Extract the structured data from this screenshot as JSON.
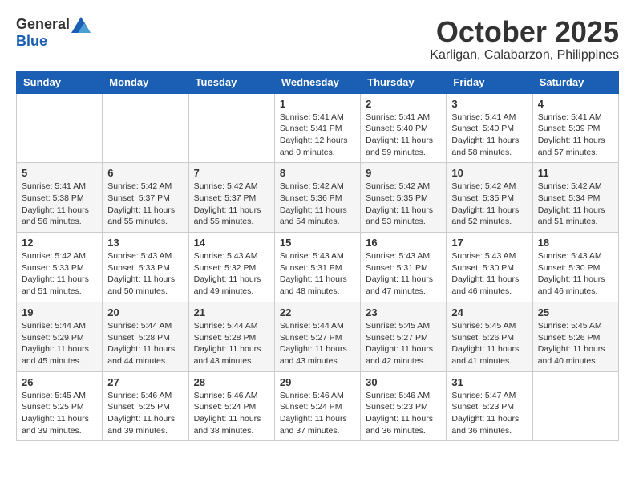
{
  "header": {
    "logo_general": "General",
    "logo_blue": "Blue",
    "month": "October 2025",
    "location": "Karligan, Calabarzon, Philippines"
  },
  "weekdays": [
    "Sunday",
    "Monday",
    "Tuesday",
    "Wednesday",
    "Thursday",
    "Friday",
    "Saturday"
  ],
  "weeks": [
    [
      {
        "day": "",
        "info": ""
      },
      {
        "day": "",
        "info": ""
      },
      {
        "day": "",
        "info": ""
      },
      {
        "day": "1",
        "info": "Sunrise: 5:41 AM\nSunset: 5:41 PM\nDaylight: 12 hours\nand 0 minutes."
      },
      {
        "day": "2",
        "info": "Sunrise: 5:41 AM\nSunset: 5:40 PM\nDaylight: 11 hours\nand 59 minutes."
      },
      {
        "day": "3",
        "info": "Sunrise: 5:41 AM\nSunset: 5:40 PM\nDaylight: 11 hours\nand 58 minutes."
      },
      {
        "day": "4",
        "info": "Sunrise: 5:41 AM\nSunset: 5:39 PM\nDaylight: 11 hours\nand 57 minutes."
      }
    ],
    [
      {
        "day": "5",
        "info": "Sunrise: 5:41 AM\nSunset: 5:38 PM\nDaylight: 11 hours\nand 56 minutes."
      },
      {
        "day": "6",
        "info": "Sunrise: 5:42 AM\nSunset: 5:37 PM\nDaylight: 11 hours\nand 55 minutes."
      },
      {
        "day": "7",
        "info": "Sunrise: 5:42 AM\nSunset: 5:37 PM\nDaylight: 11 hours\nand 55 minutes."
      },
      {
        "day": "8",
        "info": "Sunrise: 5:42 AM\nSunset: 5:36 PM\nDaylight: 11 hours\nand 54 minutes."
      },
      {
        "day": "9",
        "info": "Sunrise: 5:42 AM\nSunset: 5:35 PM\nDaylight: 11 hours\nand 53 minutes."
      },
      {
        "day": "10",
        "info": "Sunrise: 5:42 AM\nSunset: 5:35 PM\nDaylight: 11 hours\nand 52 minutes."
      },
      {
        "day": "11",
        "info": "Sunrise: 5:42 AM\nSunset: 5:34 PM\nDaylight: 11 hours\nand 51 minutes."
      }
    ],
    [
      {
        "day": "12",
        "info": "Sunrise: 5:42 AM\nSunset: 5:33 PM\nDaylight: 11 hours\nand 51 minutes."
      },
      {
        "day": "13",
        "info": "Sunrise: 5:43 AM\nSunset: 5:33 PM\nDaylight: 11 hours\nand 50 minutes."
      },
      {
        "day": "14",
        "info": "Sunrise: 5:43 AM\nSunset: 5:32 PM\nDaylight: 11 hours\nand 49 minutes."
      },
      {
        "day": "15",
        "info": "Sunrise: 5:43 AM\nSunset: 5:31 PM\nDaylight: 11 hours\nand 48 minutes."
      },
      {
        "day": "16",
        "info": "Sunrise: 5:43 AM\nSunset: 5:31 PM\nDaylight: 11 hours\nand 47 minutes."
      },
      {
        "day": "17",
        "info": "Sunrise: 5:43 AM\nSunset: 5:30 PM\nDaylight: 11 hours\nand 46 minutes."
      },
      {
        "day": "18",
        "info": "Sunrise: 5:43 AM\nSunset: 5:30 PM\nDaylight: 11 hours\nand 46 minutes."
      }
    ],
    [
      {
        "day": "19",
        "info": "Sunrise: 5:44 AM\nSunset: 5:29 PM\nDaylight: 11 hours\nand 45 minutes."
      },
      {
        "day": "20",
        "info": "Sunrise: 5:44 AM\nSunset: 5:28 PM\nDaylight: 11 hours\nand 44 minutes."
      },
      {
        "day": "21",
        "info": "Sunrise: 5:44 AM\nSunset: 5:28 PM\nDaylight: 11 hours\nand 43 minutes."
      },
      {
        "day": "22",
        "info": "Sunrise: 5:44 AM\nSunset: 5:27 PM\nDaylight: 11 hours\nand 43 minutes."
      },
      {
        "day": "23",
        "info": "Sunrise: 5:45 AM\nSunset: 5:27 PM\nDaylight: 11 hours\nand 42 minutes."
      },
      {
        "day": "24",
        "info": "Sunrise: 5:45 AM\nSunset: 5:26 PM\nDaylight: 11 hours\nand 41 minutes."
      },
      {
        "day": "25",
        "info": "Sunrise: 5:45 AM\nSunset: 5:26 PM\nDaylight: 11 hours\nand 40 minutes."
      }
    ],
    [
      {
        "day": "26",
        "info": "Sunrise: 5:45 AM\nSunset: 5:25 PM\nDaylight: 11 hours\nand 39 minutes."
      },
      {
        "day": "27",
        "info": "Sunrise: 5:46 AM\nSunset: 5:25 PM\nDaylight: 11 hours\nand 39 minutes."
      },
      {
        "day": "28",
        "info": "Sunrise: 5:46 AM\nSunset: 5:24 PM\nDaylight: 11 hours\nand 38 minutes."
      },
      {
        "day": "29",
        "info": "Sunrise: 5:46 AM\nSunset: 5:24 PM\nDaylight: 11 hours\nand 37 minutes."
      },
      {
        "day": "30",
        "info": "Sunrise: 5:46 AM\nSunset: 5:23 PM\nDaylight: 11 hours\nand 36 minutes."
      },
      {
        "day": "31",
        "info": "Sunrise: 5:47 AM\nSunset: 5:23 PM\nDaylight: 11 hours\nand 36 minutes."
      },
      {
        "day": "",
        "info": ""
      }
    ]
  ]
}
